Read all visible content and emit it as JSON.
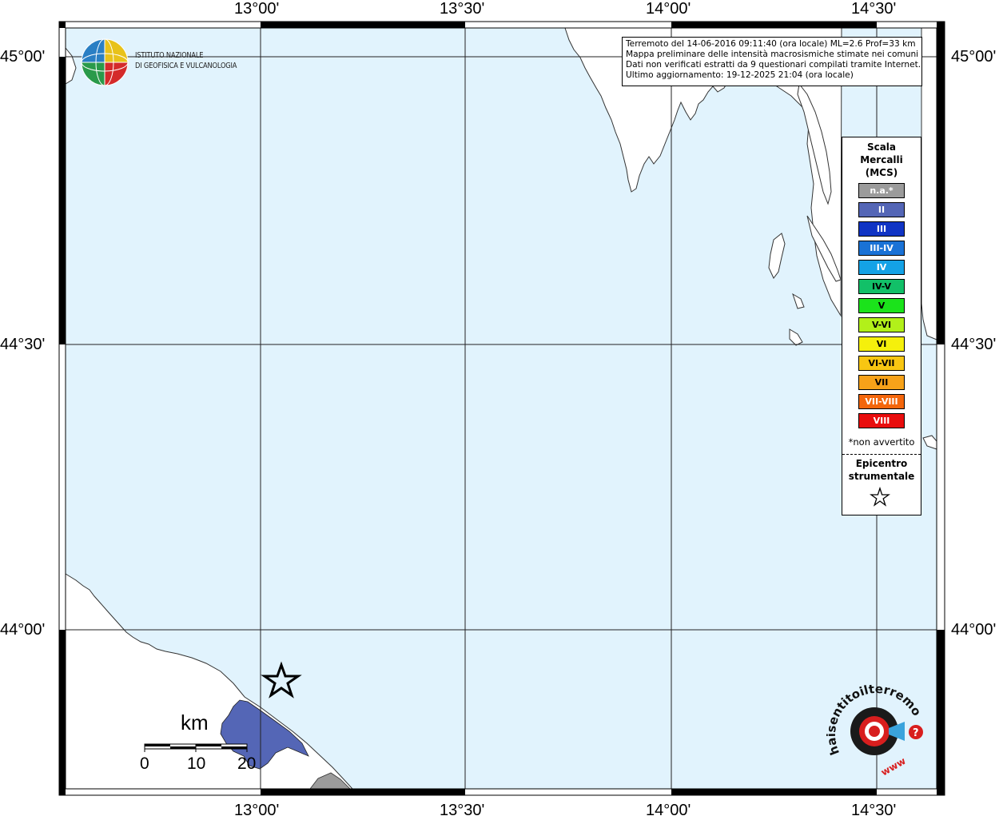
{
  "map": {
    "colors": {
      "sea": "#e1f3fd",
      "land": "#ffffff",
      "grid": "#000000",
      "intensity_ii": "#5466b6",
      "not_available": "#9b9b9b"
    },
    "lon_labels_top": [
      "13°00'",
      "13°30'",
      "14°00'",
      "14°30'"
    ],
    "lon_labels_bottom": [
      "13°00'",
      "13°30'",
      "14°00'",
      "14°30'"
    ],
    "lat_labels_left": [
      "45°00'",
      "44°30'",
      "44°00'"
    ],
    "lat_labels_right": [
      "45°00'",
      "44°30'",
      "44°00'"
    ]
  },
  "institution": {
    "line1": "ISTITUTO NAZIONALE",
    "line2": "DI GEOFISICA E VULCANOLOGIA"
  },
  "info_box": {
    "line1": "Terremoto del 14-06-2016 09:11:40 (ora locale) ML=2.6 Prof=33 km",
    "line2": "Mappa preliminare delle intensità macrosismiche stimate nei comuni",
    "line3": "Dati non verificati estratti da 9 questionari compilati tramite Internet.",
    "line4": "Ultimo aggiornamento: 19-12-2025 21:04 (ora locale)"
  },
  "legend": {
    "title_line1": "Scala",
    "title_line2": "Mercalli",
    "title_line3": "(MCS)",
    "items": [
      {
        "label": "n.a.*",
        "color": "#9b9b9b"
      },
      {
        "label": "II",
        "color": "#5466b6"
      },
      {
        "label": "III",
        "color": "#1034c4"
      },
      {
        "label": "III-IV",
        "color": "#1a72d6"
      },
      {
        "label": "IV",
        "color": "#14a2e6"
      },
      {
        "label": "IV-V",
        "color": "#12c068"
      },
      {
        "label": "V",
        "color": "#1be31b"
      },
      {
        "label": "V-VI",
        "color": "#b2f01a"
      },
      {
        "label": "VI",
        "color": "#f5f00c"
      },
      {
        "label": "VI-VII",
        "color": "#f8c612"
      },
      {
        "label": "VII",
        "color": "#f7a219"
      },
      {
        "label": "VII-VIII",
        "color": "#f4660c"
      },
      {
        "label": "VIII",
        "color": "#e90d0d"
      }
    ],
    "note": "*non avvertito",
    "epicenter_line1": "Epicentro",
    "epicenter_line2": "strumentale"
  },
  "scale_bar": {
    "unit": "km",
    "ticks": [
      "0",
      "10",
      "20"
    ]
  },
  "badge": {
    "brand_text": "haisentitoilterremoto.it",
    "url_text": "www"
  }
}
